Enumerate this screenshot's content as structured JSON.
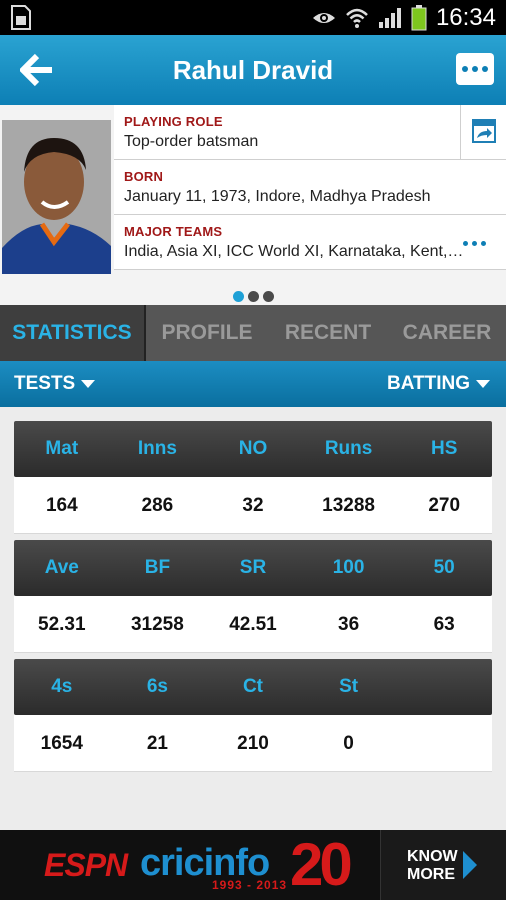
{
  "status_bar": {
    "time": "16:34",
    "battery_color": "#7ec61e"
  },
  "app_bar": {
    "title": "Rahul Dravid"
  },
  "profile": {
    "rows": [
      {
        "label": "PLAYING ROLE",
        "value": "Top-order batsman"
      },
      {
        "label": "BORN",
        "value": "January 11, 1973, Indore, Madhya Pradesh"
      },
      {
        "label": "MAJOR TEAMS",
        "value": "India, Asia XI, ICC World XI, Karnataka, Kent, Marylebone Cricket Club"
      }
    ],
    "pager": {
      "count": 3,
      "active": 1
    }
  },
  "tabs": [
    {
      "label": "STATISTICS",
      "active": true
    },
    {
      "label": "PROFILE",
      "active": false
    },
    {
      "label": "RECENT",
      "active": false
    },
    {
      "label": "CAREER",
      "active": false
    }
  ],
  "filters": {
    "format": "TESTS",
    "discipline": "BATTING"
  },
  "stats": [
    {
      "headers": [
        "Mat",
        "Inns",
        "NO",
        "Runs",
        "HS"
      ],
      "values": [
        "164",
        "286",
        "32",
        "13288",
        "270"
      ]
    },
    {
      "headers": [
        "Ave",
        "BF",
        "SR",
        "100",
        "50"
      ],
      "values": [
        "52.31",
        "31258",
        "42.51",
        "36",
        "63"
      ]
    },
    {
      "headers": [
        "4s",
        "6s",
        "Ct",
        "St",
        ""
      ],
      "values": [
        "1654",
        "21",
        "210",
        "0",
        ""
      ]
    }
  ],
  "ad": {
    "espn": "ESPN",
    "cricinfo": "cricinfo",
    "anniversary": "20",
    "years": "1993 - 2013",
    "cta_line1": "KNOW",
    "cta_line2": "MORE"
  },
  "colors": {
    "accent": "#1ea0d6",
    "label_red": "#a01818",
    "tab_active": "#2ab3e6"
  }
}
